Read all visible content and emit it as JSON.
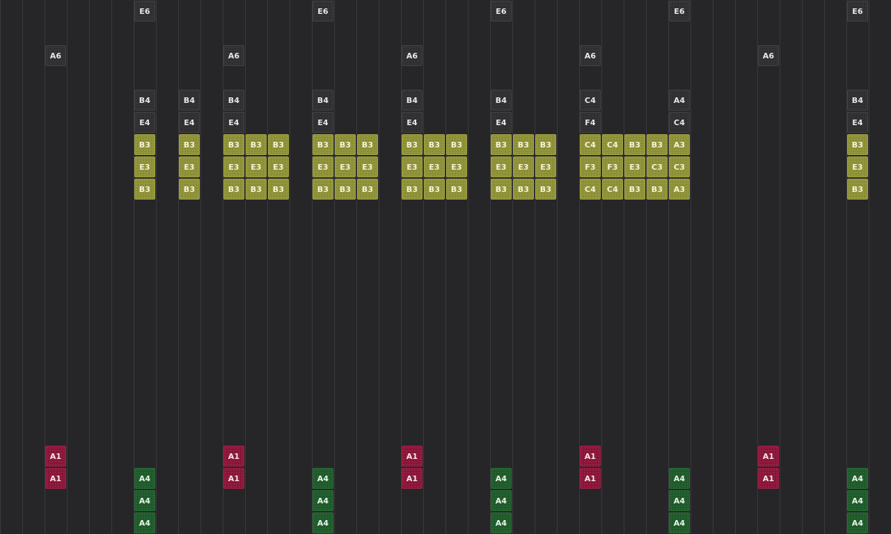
{
  "colors": {
    "background": "#262628",
    "gridline": "#3a3a3e",
    "melody": "#2f2f31",
    "chord": "#8c8f33",
    "bass": "#8a1438",
    "drum": "#1e5a2a"
  },
  "notes": [
    {
      "label": "E6",
      "col": 6,
      "row": 0,
      "kind": "melody"
    },
    {
      "label": "E6",
      "col": 14,
      "row": 0,
      "kind": "melody"
    },
    {
      "label": "E6",
      "col": 22,
      "row": 0,
      "kind": "melody"
    },
    {
      "label": "E6",
      "col": 30,
      "row": 0,
      "kind": "melody"
    },
    {
      "label": "E6",
      "col": 38,
      "row": 0,
      "kind": "melody"
    },
    {
      "label": "A6",
      "col": 2,
      "row": 2,
      "kind": "melody"
    },
    {
      "label": "A6",
      "col": 10,
      "row": 2,
      "kind": "melody"
    },
    {
      "label": "A6",
      "col": 18,
      "row": 2,
      "kind": "melody"
    },
    {
      "label": "A6",
      "col": 26,
      "row": 2,
      "kind": "melody"
    },
    {
      "label": "A6",
      "col": 34,
      "row": 2,
      "kind": "melody"
    },
    {
      "label": "B4",
      "col": 6,
      "row": 4,
      "kind": "melody"
    },
    {
      "label": "B4",
      "col": 8,
      "row": 4,
      "kind": "melody"
    },
    {
      "label": "B4",
      "col": 10,
      "row": 4,
      "kind": "melody"
    },
    {
      "label": "B4",
      "col": 14,
      "row": 4,
      "kind": "melody"
    },
    {
      "label": "B4",
      "col": 18,
      "row": 4,
      "kind": "melody"
    },
    {
      "label": "B4",
      "col": 22,
      "row": 4,
      "kind": "melody"
    },
    {
      "label": "C4",
      "col": 26,
      "row": 4,
      "kind": "melody"
    },
    {
      "label": "A4",
      "col": 30,
      "row": 4,
      "kind": "melody"
    },
    {
      "label": "B4",
      "col": 38,
      "row": 4,
      "kind": "melody"
    },
    {
      "label": "E4",
      "col": 6,
      "row": 5,
      "kind": "melody"
    },
    {
      "label": "E4",
      "col": 8,
      "row": 5,
      "kind": "melody"
    },
    {
      "label": "E4",
      "col": 10,
      "row": 5,
      "kind": "melody"
    },
    {
      "label": "E4",
      "col": 14,
      "row": 5,
      "kind": "melody"
    },
    {
      "label": "E4",
      "col": 18,
      "row": 5,
      "kind": "melody"
    },
    {
      "label": "E4",
      "col": 22,
      "row": 5,
      "kind": "melody"
    },
    {
      "label": "F4",
      "col": 26,
      "row": 5,
      "kind": "melody"
    },
    {
      "label": "C4",
      "col": 30,
      "row": 5,
      "kind": "melody"
    },
    {
      "label": "E4",
      "col": 38,
      "row": 5,
      "kind": "melody"
    },
    {
      "label": "B3",
      "col": 6,
      "row": 6,
      "kind": "chord"
    },
    {
      "label": "B3",
      "col": 8,
      "row": 6,
      "kind": "chord"
    },
    {
      "label": "B3",
      "col": 10,
      "row": 6,
      "kind": "chord"
    },
    {
      "label": "B3",
      "col": 11,
      "row": 6,
      "kind": "chord"
    },
    {
      "label": "B3",
      "col": 12,
      "row": 6,
      "kind": "chord"
    },
    {
      "label": "B3",
      "col": 14,
      "row": 6,
      "kind": "chord"
    },
    {
      "label": "B3",
      "col": 15,
      "row": 6,
      "kind": "chord"
    },
    {
      "label": "B3",
      "col": 16,
      "row": 6,
      "kind": "chord"
    },
    {
      "label": "B3",
      "col": 18,
      "row": 6,
      "kind": "chord"
    },
    {
      "label": "B3",
      "col": 19,
      "row": 6,
      "kind": "chord"
    },
    {
      "label": "B3",
      "col": 20,
      "row": 6,
      "kind": "chord"
    },
    {
      "label": "B3",
      "col": 22,
      "row": 6,
      "kind": "chord"
    },
    {
      "label": "B3",
      "col": 23,
      "row": 6,
      "kind": "chord"
    },
    {
      "label": "B3",
      "col": 24,
      "row": 6,
      "kind": "chord"
    },
    {
      "label": "C4",
      "col": 26,
      "row": 6,
      "kind": "chord"
    },
    {
      "label": "C4",
      "col": 27,
      "row": 6,
      "kind": "chord"
    },
    {
      "label": "B3",
      "col": 28,
      "row": 6,
      "kind": "chord"
    },
    {
      "label": "B3",
      "col": 29,
      "row": 6,
      "kind": "chord"
    },
    {
      "label": "A3",
      "col": 30,
      "row": 6,
      "kind": "chord"
    },
    {
      "label": "B3",
      "col": 38,
      "row": 6,
      "kind": "chord"
    },
    {
      "label": "E3",
      "col": 6,
      "row": 7,
      "kind": "chord"
    },
    {
      "label": "E3",
      "col": 8,
      "row": 7,
      "kind": "chord"
    },
    {
      "label": "E3",
      "col": 10,
      "row": 7,
      "kind": "chord"
    },
    {
      "label": "E3",
      "col": 11,
      "row": 7,
      "kind": "chord"
    },
    {
      "label": "E3",
      "col": 12,
      "row": 7,
      "kind": "chord"
    },
    {
      "label": "E3",
      "col": 14,
      "row": 7,
      "kind": "chord"
    },
    {
      "label": "E3",
      "col": 15,
      "row": 7,
      "kind": "chord"
    },
    {
      "label": "E3",
      "col": 16,
      "row": 7,
      "kind": "chord"
    },
    {
      "label": "E3",
      "col": 18,
      "row": 7,
      "kind": "chord"
    },
    {
      "label": "E3",
      "col": 19,
      "row": 7,
      "kind": "chord"
    },
    {
      "label": "E3",
      "col": 20,
      "row": 7,
      "kind": "chord"
    },
    {
      "label": "E3",
      "col": 22,
      "row": 7,
      "kind": "chord"
    },
    {
      "label": "E3",
      "col": 23,
      "row": 7,
      "kind": "chord"
    },
    {
      "label": "E3",
      "col": 24,
      "row": 7,
      "kind": "chord"
    },
    {
      "label": "F3",
      "col": 26,
      "row": 7,
      "kind": "chord"
    },
    {
      "label": "F3",
      "col": 27,
      "row": 7,
      "kind": "chord"
    },
    {
      "label": "E3",
      "col": 28,
      "row": 7,
      "kind": "chord"
    },
    {
      "label": "C3",
      "col": 29,
      "row": 7,
      "kind": "chord"
    },
    {
      "label": "C3",
      "col": 30,
      "row": 7,
      "kind": "chord"
    },
    {
      "label": "E3",
      "col": 38,
      "row": 7,
      "kind": "chord"
    },
    {
      "label": "B3",
      "col": 6,
      "row": 8,
      "kind": "chord"
    },
    {
      "label": "B3",
      "col": 8,
      "row": 8,
      "kind": "chord"
    },
    {
      "label": "B3",
      "col": 10,
      "row": 8,
      "kind": "chord"
    },
    {
      "label": "B3",
      "col": 11,
      "row": 8,
      "kind": "chord"
    },
    {
      "label": "B3",
      "col": 12,
      "row": 8,
      "kind": "chord"
    },
    {
      "label": "B3",
      "col": 14,
      "row": 8,
      "kind": "chord"
    },
    {
      "label": "B3",
      "col": 15,
      "row": 8,
      "kind": "chord"
    },
    {
      "label": "B3",
      "col": 16,
      "row": 8,
      "kind": "chord"
    },
    {
      "label": "B3",
      "col": 18,
      "row": 8,
      "kind": "chord"
    },
    {
      "label": "B3",
      "col": 19,
      "row": 8,
      "kind": "chord"
    },
    {
      "label": "B3",
      "col": 20,
      "row": 8,
      "kind": "chord"
    },
    {
      "label": "B3",
      "col": 22,
      "row": 8,
      "kind": "chord"
    },
    {
      "label": "B3",
      "col": 23,
      "row": 8,
      "kind": "chord"
    },
    {
      "label": "B3",
      "col": 24,
      "row": 8,
      "kind": "chord"
    },
    {
      "label": "C4",
      "col": 26,
      "row": 8,
      "kind": "chord"
    },
    {
      "label": "C4",
      "col": 27,
      "row": 8,
      "kind": "chord"
    },
    {
      "label": "B3",
      "col": 28,
      "row": 8,
      "kind": "chord"
    },
    {
      "label": "B3",
      "col": 29,
      "row": 8,
      "kind": "chord"
    },
    {
      "label": "A3",
      "col": 30,
      "row": 8,
      "kind": "chord"
    },
    {
      "label": "B3",
      "col": 38,
      "row": 8,
      "kind": "chord"
    },
    {
      "label": "A1",
      "col": 2,
      "row": 20,
      "kind": "bass"
    },
    {
      "label": "A1",
      "col": 10,
      "row": 20,
      "kind": "bass"
    },
    {
      "label": "A1",
      "col": 18,
      "row": 20,
      "kind": "bass"
    },
    {
      "label": "A1",
      "col": 26,
      "row": 20,
      "kind": "bass"
    },
    {
      "label": "A1",
      "col": 34,
      "row": 20,
      "kind": "bass"
    },
    {
      "label": "A1",
      "col": 2,
      "row": 21,
      "kind": "bass"
    },
    {
      "label": "A1",
      "col": 10,
      "row": 21,
      "kind": "bass"
    },
    {
      "label": "A1",
      "col": 18,
      "row": 21,
      "kind": "bass"
    },
    {
      "label": "A1",
      "col": 26,
      "row": 21,
      "kind": "bass"
    },
    {
      "label": "A1",
      "col": 34,
      "row": 21,
      "kind": "bass"
    },
    {
      "label": "A4",
      "col": 6,
      "row": 21,
      "kind": "drum"
    },
    {
      "label": "A4",
      "col": 14,
      "row": 21,
      "kind": "drum"
    },
    {
      "label": "A4",
      "col": 22,
      "row": 21,
      "kind": "drum"
    },
    {
      "label": "A4",
      "col": 30,
      "row": 21,
      "kind": "drum"
    },
    {
      "label": "A4",
      "col": 38,
      "row": 21,
      "kind": "drum"
    },
    {
      "label": "A4",
      "col": 6,
      "row": 22,
      "kind": "drum"
    },
    {
      "label": "A4",
      "col": 14,
      "row": 22,
      "kind": "drum"
    },
    {
      "label": "A4",
      "col": 22,
      "row": 22,
      "kind": "drum"
    },
    {
      "label": "A4",
      "col": 30,
      "row": 22,
      "kind": "drum"
    },
    {
      "label": "A4",
      "col": 38,
      "row": 22,
      "kind": "drum"
    },
    {
      "label": "A4",
      "col": 6,
      "row": 23,
      "kind": "drum"
    },
    {
      "label": "A4",
      "col": 14,
      "row": 23,
      "kind": "drum"
    },
    {
      "label": "A4",
      "col": 22,
      "row": 23,
      "kind": "drum"
    },
    {
      "label": "A4",
      "col": 30,
      "row": 23,
      "kind": "drum"
    },
    {
      "label": "A4",
      "col": 38,
      "row": 23,
      "kind": "drum"
    }
  ]
}
